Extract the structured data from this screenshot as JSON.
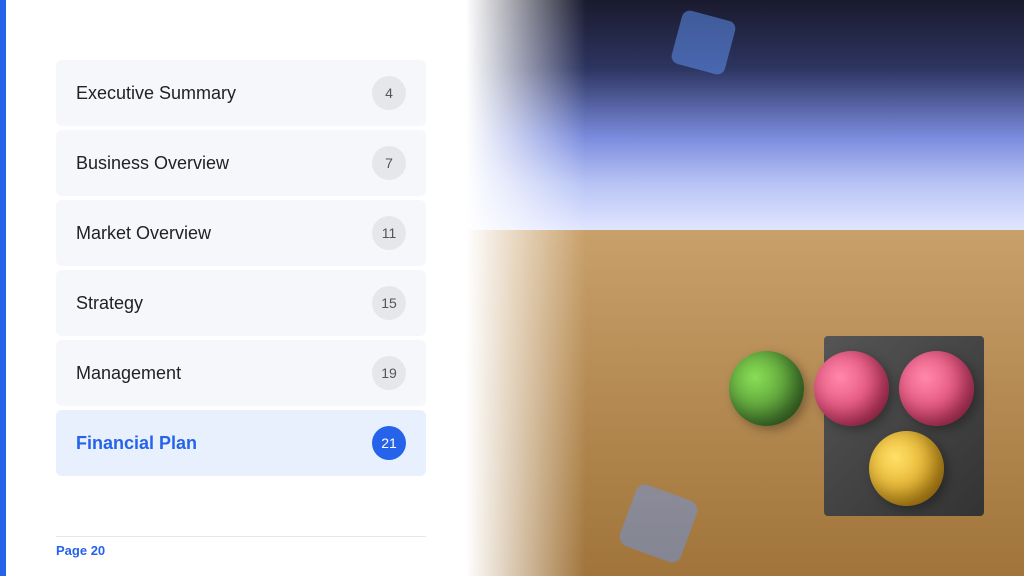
{
  "page": {
    "footer": {
      "label": "Page ",
      "number": "20"
    }
  },
  "toc": {
    "items": [
      {
        "id": "executive-summary",
        "label": "Executive Summary",
        "page": "4",
        "active": false
      },
      {
        "id": "business-overview",
        "label": "Business Overview",
        "page": "7",
        "active": false
      },
      {
        "id": "market-overview",
        "label": "Market Overview",
        "page": "11",
        "active": false
      },
      {
        "id": "strategy",
        "label": "Strategy",
        "page": "15",
        "active": false
      },
      {
        "id": "management",
        "label": "Management",
        "page": "19",
        "active": false
      },
      {
        "id": "financial-plan",
        "label": "Financial Plan",
        "page": "21",
        "active": true
      }
    ]
  },
  "accents": {
    "blue": "#2563eb",
    "light_blue": "#6398fc"
  }
}
